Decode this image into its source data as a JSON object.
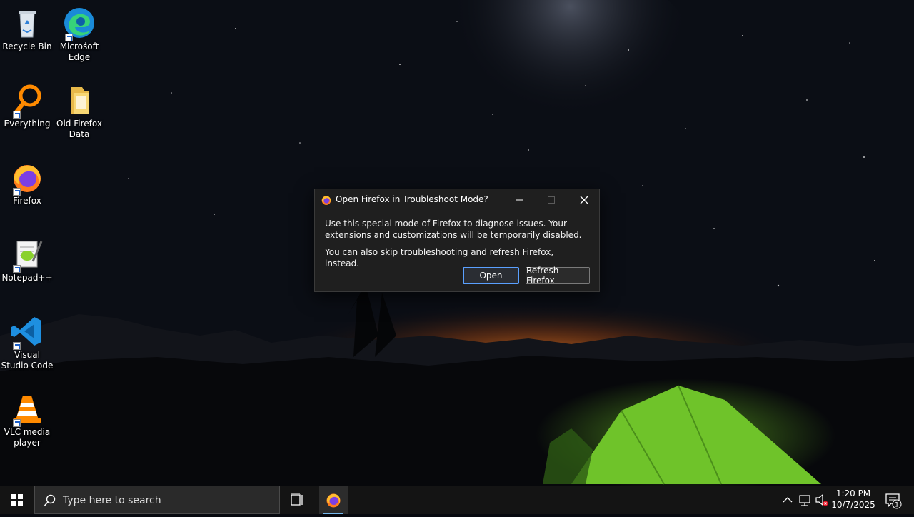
{
  "desktop": {
    "icons": [
      {
        "label": "Recycle Bin",
        "icon": "recycle-bin-icon"
      },
      {
        "label": "Microsoft Edge",
        "icon": "edge-icon"
      },
      {
        "label": "Everything",
        "icon": "everything-icon"
      },
      {
        "label": "Old Firefox Data",
        "icon": "folder-icon"
      },
      {
        "label": "Firefox",
        "icon": "firefox-icon"
      },
      {
        "label": "Notepad++",
        "icon": "notepad-plus-plus-icon"
      },
      {
        "label": "Visual Studio Code",
        "icon": "vscode-icon"
      },
      {
        "label": "VLC media player",
        "icon": "vlc-icon"
      }
    ]
  },
  "dialog": {
    "title": "Open Firefox in Troubleshoot Mode?",
    "message1": "Use this special mode of Firefox to diagnose issues. Your extensions and customizations will be temporarily disabled.",
    "message2": "You can also skip troubleshooting and refresh Firefox, instead.",
    "open_label": "Open",
    "refresh_label": "Refresh Firefox"
  },
  "taskbar": {
    "search_placeholder": "Type here to search",
    "time": "1:20 PM",
    "date": "10/7/2025",
    "notification_count": "1"
  },
  "colors": {
    "accent": "#5aa0ff",
    "taskbar_bg": "#141414",
    "dialog_bg": "#1f1f1f"
  }
}
